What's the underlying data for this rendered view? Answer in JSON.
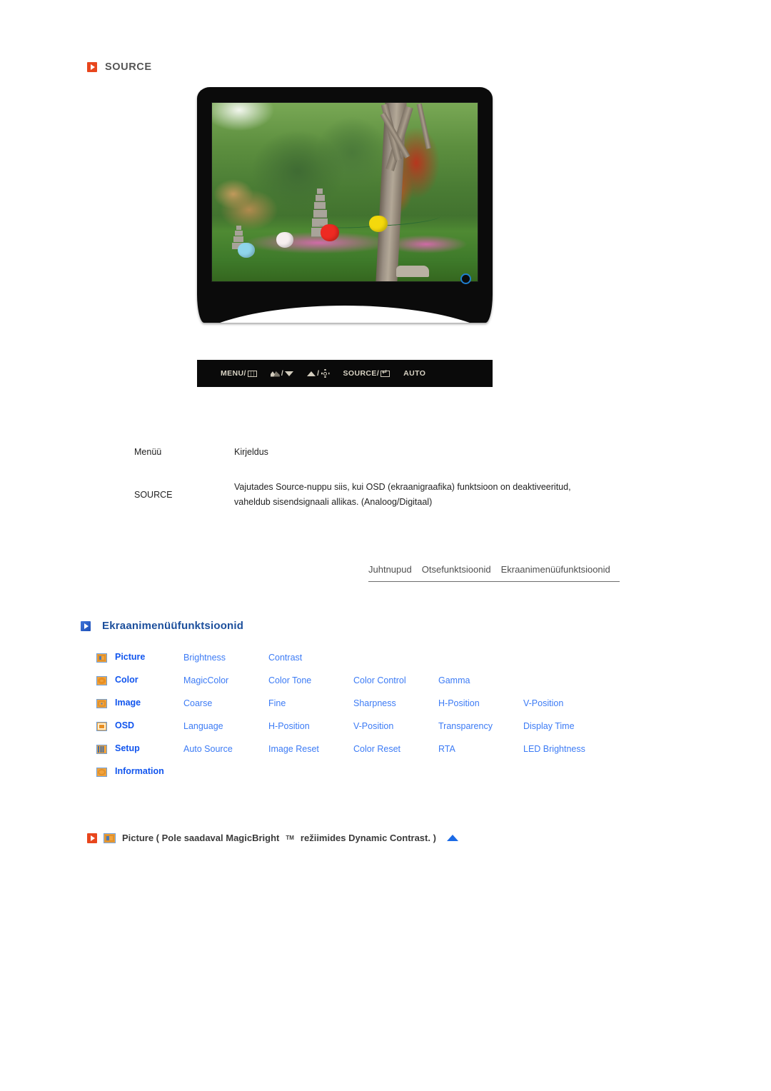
{
  "page": {
    "source_heading": "SOURCE"
  },
  "monitor": {
    "screen_photo_alt": "Korean garden with stone pagoda, trees and paper lanterns",
    "power_led": "power-led",
    "controls": [
      {
        "label": "MENU/",
        "icon": "menu-grid-icon"
      },
      {
        "label": "/",
        "icon": "magicbright-icon",
        "icon2": "down-arrow-icon"
      },
      {
        "label": "/",
        "icon": "up-arrow-icon",
        "icon2": "brightness-sun-icon"
      },
      {
        "label": "SOURCE/",
        "icon": "enter-icon"
      },
      {
        "label": "AUTO",
        "icon": ""
      }
    ]
  },
  "description_table": {
    "headers": {
      "menu": "Menüü",
      "description": "Kirjeldus"
    },
    "rows": [
      {
        "menu": "SOURCE",
        "description": "Vajutades Source-nuppu siis, kui OSD (ekraanigraafika) funktsioon on deaktiveeritud, vaheldub sisendsignaali allikas. (Analoog/Digitaal)"
      }
    ]
  },
  "tabs": [
    {
      "label": "Juhtnupud"
    },
    {
      "label": "Otsefunktsioonid"
    },
    {
      "label": "Ekraanimenüüfunktsioonid"
    }
  ],
  "section": {
    "title": "Ekraanimenüüfunktsioonid"
  },
  "osd_menu": {
    "rows": [
      {
        "icon": "picture",
        "name": "Picture",
        "items": [
          "Brightness",
          "Contrast",
          "",
          "",
          ""
        ]
      },
      {
        "icon": "color",
        "name": "Color",
        "items": [
          "MagicColor",
          "Color Tone",
          "Color Control",
          "Gamma",
          ""
        ]
      },
      {
        "icon": "image",
        "name": "Image",
        "items": [
          "Coarse",
          "Fine",
          "Sharpness",
          "H-Position",
          "V-Position"
        ]
      },
      {
        "icon": "osd",
        "name": "OSD",
        "items": [
          "Language",
          "H-Position",
          "V-Position",
          "Transparency",
          "Display Time"
        ]
      },
      {
        "icon": "setup",
        "name": "Setup",
        "items": [
          "Auto Source",
          "Image Reset",
          "Color Reset",
          "RTA",
          "LED Brightness"
        ]
      },
      {
        "icon": "info",
        "name": "Information",
        "items": [
          "",
          "",
          "",
          "",
          ""
        ]
      }
    ]
  },
  "note": {
    "prefix": "Picture ( Pole saadaval MagicBright",
    "tm": "TM",
    "suffix": " režiimides Dynamic Contrast. )"
  },
  "colors": {
    "accent_orange": "#e8461d",
    "accent_blue": "#1c4f9c",
    "link_blue": "#3c7bf5",
    "menu_blue": "#1155ee",
    "icon_orange": "#f2a33c",
    "text_gray": "#333333"
  }
}
